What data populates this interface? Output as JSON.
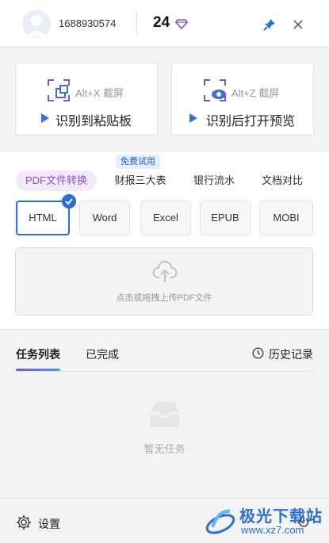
{
  "header": {
    "user_id": "1688930574",
    "credits": "24",
    "icons": {
      "avatar": "avatar",
      "credits": "diamond-icon",
      "pin": "pin-icon",
      "close": "close-icon"
    }
  },
  "ocr": {
    "cards": [
      {
        "hotkey": "Alt+X 截屏",
        "action": "识别到粘贴板",
        "icon": "screenshot-copy-icon"
      },
      {
        "hotkey": "Alt+Z 截屏",
        "action": "识别后打开预览",
        "icon": "screenshot-preview-icon"
      }
    ]
  },
  "convert": {
    "badge": "免费试用",
    "tabs": [
      {
        "label": "PDF文件转换",
        "active": true
      },
      {
        "label": "财报三大表"
      },
      {
        "label": "银行流水"
      },
      {
        "label": "文档对比"
      }
    ],
    "formats": [
      {
        "label": "HTML",
        "selected": true
      },
      {
        "label": "Word"
      },
      {
        "label": "Excel"
      },
      {
        "label": "EPUB"
      },
      {
        "label": "MOBI"
      }
    ],
    "upload_hint": "点击或拖拽上传PDF文件"
  },
  "tasks": {
    "tabs": [
      {
        "label": "任务列表",
        "active": true
      },
      {
        "label": "已完成"
      }
    ],
    "history": "历史记录",
    "empty": "暂无任务"
  },
  "footer": {
    "settings": "设置",
    "watermark_name": "极光下载站",
    "watermark_url": "www.xz7.com"
  },
  "colors": {
    "accent_blue": "#2a6fd6",
    "accent_purple": "#8a4fd6",
    "badge_bg": "#e3efff"
  }
}
